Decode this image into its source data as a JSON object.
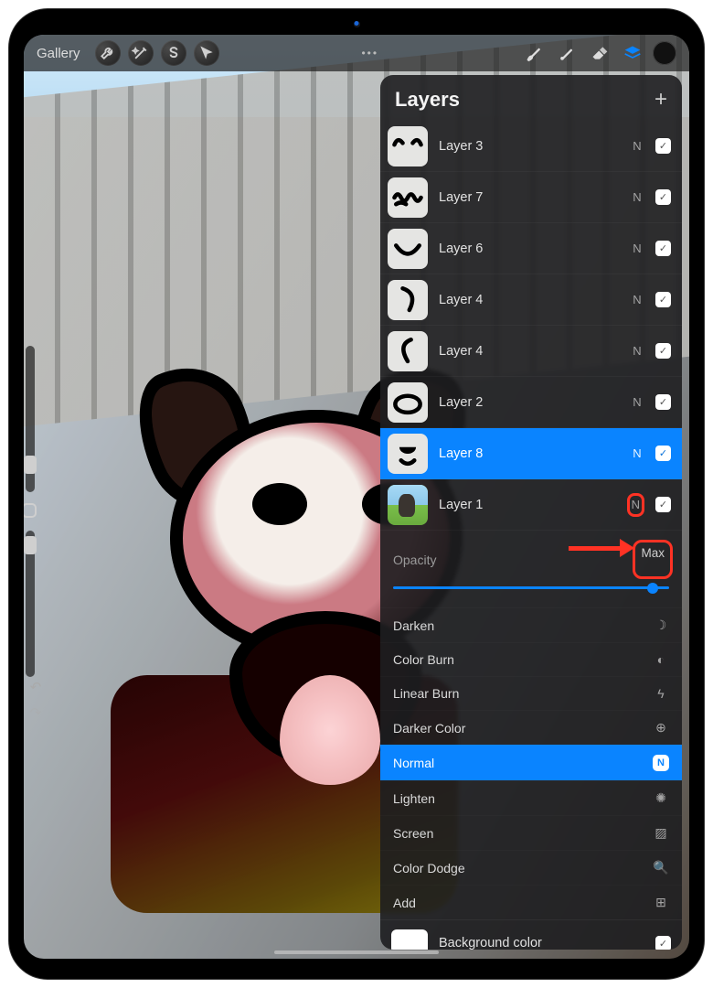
{
  "topbar": {
    "gallery_label": "Gallery",
    "tools": {
      "wrench": "wrench-icon",
      "wand": "wand-icon",
      "select": "select-icon",
      "cursor": "cursor-icon",
      "brush": "brush-icon",
      "smudge": "smudge-icon",
      "eraser": "eraser-icon",
      "layers": "layers-icon"
    }
  },
  "panel": {
    "title": "Layers",
    "add_label": "+",
    "opacity_label": "Opacity",
    "opacity_value": "Max",
    "background_label": "Background color"
  },
  "layers": [
    {
      "name": "Layer 3",
      "blend": "N",
      "visible": true,
      "selected": false,
      "thumb": "ears"
    },
    {
      "name": "Layer 7",
      "blend": "N",
      "visible": true,
      "selected": false,
      "thumb": "scribble"
    },
    {
      "name": "Layer 6",
      "blend": "N",
      "visible": true,
      "selected": false,
      "thumb": "smile"
    },
    {
      "name": "Layer 4",
      "blend": "N",
      "visible": true,
      "selected": false,
      "thumb": "curve1"
    },
    {
      "name": "Layer 4",
      "blend": "N",
      "visible": true,
      "selected": false,
      "thumb": "curve2"
    },
    {
      "name": "Layer 2",
      "blend": "N",
      "visible": true,
      "selected": false,
      "thumb": "oval"
    },
    {
      "name": "Layer 8",
      "blend": "N",
      "visible": true,
      "selected": true,
      "thumb": "nose"
    },
    {
      "name": "Layer 1",
      "blend": "N",
      "visible": true,
      "selected": false,
      "thumb": "photo",
      "blend_highlighted": true
    }
  ],
  "blend_modes": [
    {
      "label": "Darken",
      "icon": "☽",
      "selected": false
    },
    {
      "label": "Color Burn",
      "icon": "◐",
      "selected": false
    },
    {
      "label": "Linear Burn",
      "icon": "ϟ",
      "selected": false
    },
    {
      "label": "Darker Color",
      "icon": "⊕",
      "selected": false
    },
    {
      "label": "Normal",
      "icon": "N",
      "selected": true
    },
    {
      "label": "Lighten",
      "icon": "✺",
      "selected": false
    },
    {
      "label": "Screen",
      "icon": "▨",
      "selected": false
    },
    {
      "label": "Color Dodge",
      "icon": "🔍",
      "selected": false
    },
    {
      "label": "Add",
      "icon": "⊞",
      "selected": false
    }
  ],
  "colors": {
    "accent": "#0a84ff",
    "annotation": "#ff3224"
  }
}
